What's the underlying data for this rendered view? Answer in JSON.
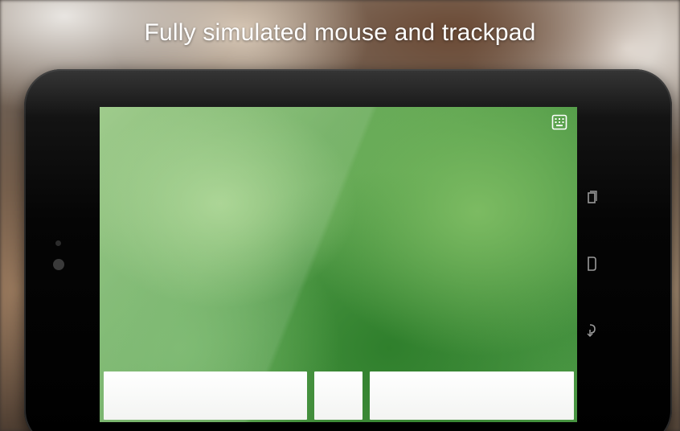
{
  "headline": "Fully simulated mouse and trackpad",
  "icons": {
    "keyboard_toggle": "keyboard-icon",
    "nav_recent": "recent-apps-icon",
    "nav_home": "home-icon",
    "nav_back": "back-icon"
  },
  "colors": {
    "trackpad_green": "#4e9444",
    "mouse_button": "#ffffff",
    "tablet_bezel": "#000000",
    "headline_text": "#ffffff"
  }
}
